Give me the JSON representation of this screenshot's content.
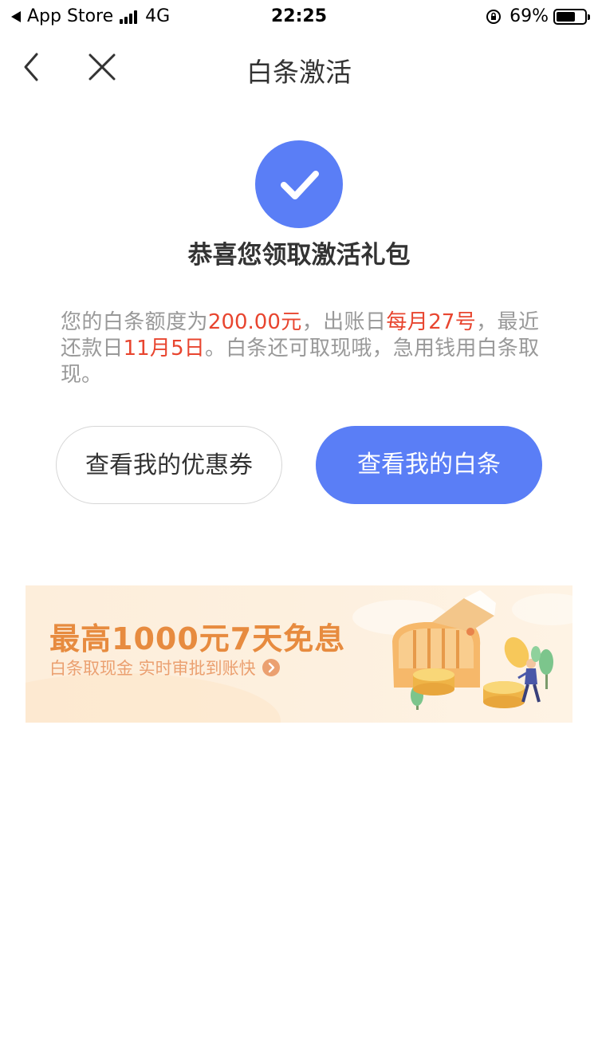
{
  "status_bar": {
    "carrier": "App Store",
    "network": "4G",
    "time": "22:25",
    "battery": "69%",
    "battery_level": 0.69
  },
  "nav": {
    "title": "白条激活",
    "back_icon": "chevron-left-icon",
    "close_icon": "close-icon"
  },
  "success": {
    "icon": "check-icon",
    "headline": "恭喜您领取激活礼包"
  },
  "description": {
    "p1": "您的白条额度为",
    "amount": "200.00元",
    "p2": "，出账日",
    "bill_day": "每月27号",
    "p3": "，最近还款日",
    "due_date": "11月5日",
    "p4": "。白条还可取现哦，急用钱用白条取现。"
  },
  "buttons": {
    "coupons": "查看我的优惠券",
    "baitiao": "查看我的白条"
  },
  "banner": {
    "title": "最高1000元7天免息",
    "subtitle": "白条取现金 实时审批到账快"
  },
  "colors": {
    "accent": "#5a7ef6",
    "highlight": "#e8452f",
    "banner_title": "#e78b3f"
  }
}
